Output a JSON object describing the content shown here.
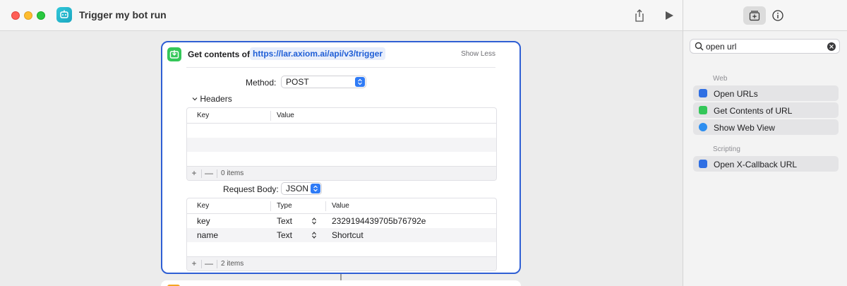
{
  "window": {
    "title": "Trigger my bot run"
  },
  "action": {
    "title": "Get contents of",
    "url": "https://lar.axiom.ai/api/v3/trigger",
    "show_less": "Show Less",
    "method_label": "Method:",
    "method_value": "POST",
    "headers_label": "Headers",
    "headers_table": {
      "columns": [
        "Key",
        "Value"
      ],
      "count": "0 items"
    },
    "request_body_label": "Request Body:",
    "request_body_value": "JSON",
    "body_table": {
      "columns": [
        "Key",
        "Type",
        "Value"
      ],
      "rows": [
        {
          "key": "key",
          "type": "Text",
          "value": "2329194439705b76792e"
        },
        {
          "key": "name",
          "type": "Text",
          "value": "Shortcut"
        }
      ],
      "count": "2 items"
    },
    "footer_add": "+",
    "footer_remove": "—"
  },
  "sidebar": {
    "search_value": "open url",
    "sections": [
      {
        "title": "Web",
        "items": [
          {
            "label": "Open URLs",
            "icon": "open-urls-icon",
            "color": "#2f6fe3"
          },
          {
            "label": "Get Contents of URL",
            "icon": "get-contents-icon",
            "color": "#34c759"
          },
          {
            "label": "Show Web View",
            "icon": "safari-icon",
            "color": "#2d8ef0"
          }
        ]
      },
      {
        "title": "Scripting",
        "items": [
          {
            "label": "Open X-Callback URL",
            "icon": "x-callback-icon",
            "color": "#2f6fe3"
          }
        ]
      }
    ]
  },
  "colors": {
    "accent": "#2f5fd4",
    "link": "#1f5ed6"
  }
}
